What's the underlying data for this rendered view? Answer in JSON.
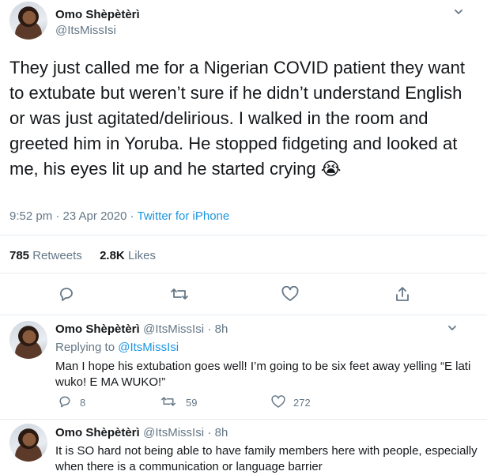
{
  "main_tweet": {
    "author_name": "Omo Shèpètèrì",
    "author_handle": "@ItsMissIsi",
    "text": "They just called me for a Nigerian COVID patient they want to extubate but weren’t sure if he didn’t understand English or was just agitated/delirious. I walked in the room and greeted him in Yoruba. He stopped fidgeting and looked at me, his eyes lit up and he started crying 😭",
    "time": "9:52 pm · 23 Apr 2020 · ",
    "source": "Twitter for iPhone",
    "retweets_count": "785",
    "retweets_label": "Retweets",
    "likes_count": "2.8K",
    "likes_label": "Likes"
  },
  "replies": [
    {
      "author_name": "Omo Shèpètèrì",
      "author_handle": "@ItsMissIsi",
      "age": "· 8h",
      "replying_prefix": "Replying to ",
      "replying_to": "@ItsMissIsi",
      "text": "Man I hope his extubation goes well! I’m going to be six feet away yelling “E lati wuko! E MA WUKO!”",
      "reply_count": "8",
      "retweet_count": "59",
      "like_count": "272"
    },
    {
      "author_name": "Omo Shèpètèrì",
      "author_handle": "@ItsMissIsi",
      "age": "· 8h",
      "text": "It is SO hard not being able to have family members here with people, especially when there is a communication or language barrier"
    }
  ],
  "icons": [
    "chevron-down-icon",
    "reply-icon",
    "retweet-icon",
    "like-icon",
    "share-icon"
  ],
  "colors": {
    "link": "#1b95e0",
    "secondary": "#657786",
    "divider": "#e6ecf0"
  }
}
